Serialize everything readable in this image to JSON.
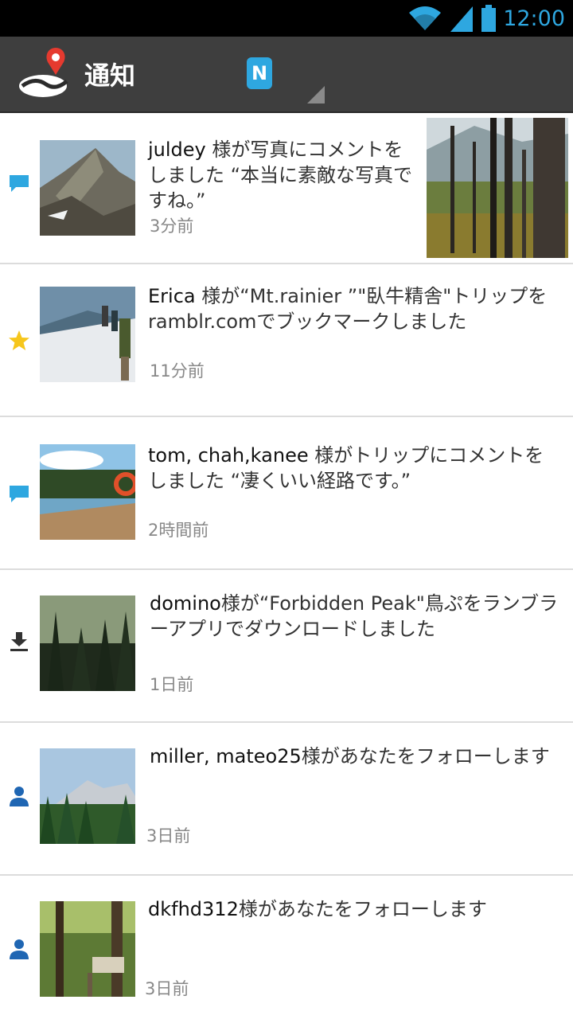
{
  "status_bar": {
    "time": "12:00",
    "icons": [
      "wifi-icon",
      "signal-icon",
      "battery-icon"
    ]
  },
  "action_bar": {
    "title": "通知",
    "badge": "N"
  },
  "notifications": [
    {
      "icon": "comment-icon",
      "name": "juldey",
      "text": " 様が写真にコメントをしました “本当に素敵な写真ですね。”",
      "time": "3分前",
      "has_photo": true
    },
    {
      "icon": "star-icon",
      "name": "Erica",
      "text": " 様が“Mt.rainier ”\"臥牛精舎\"トリップをramblr.comでブックマークしました",
      "time": "11分前"
    },
    {
      "icon": "comment-icon",
      "name": "tom, chah,kanee",
      "text": " 様がトリップにコメントをしました “凄くいい経路です。”",
      "time": "2時間前"
    },
    {
      "icon": "download-icon",
      "name": "domino",
      "text": "様が“Forbidden Peak\"鳥ぷをランブラーアプリでダウンロードしました",
      "time": "1日前"
    },
    {
      "icon": "person-icon",
      "name": "miller, mateo25",
      "text": "様があなたをフォローします",
      "time": "3日前"
    },
    {
      "icon": "person-icon",
      "name": "dkfhd312",
      "text": "様があなたをフォローします",
      "time": "3日前"
    }
  ],
  "colors": {
    "accent": "#2ea7e0",
    "action_bar": "#3e3e3e",
    "star": "#f6c61c",
    "person": "#1f66b3"
  }
}
